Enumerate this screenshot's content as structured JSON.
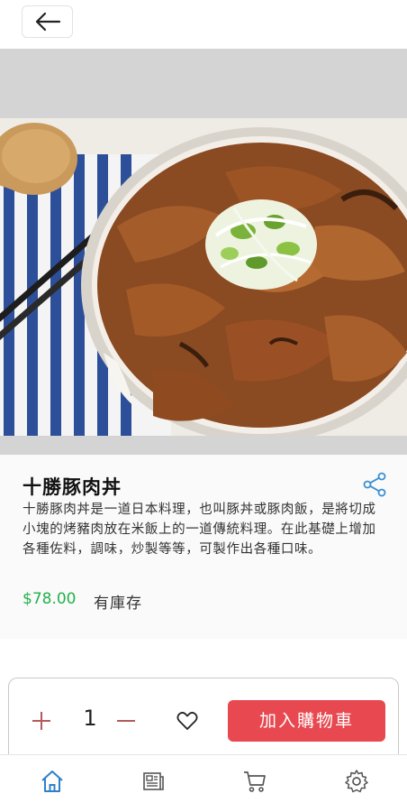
{
  "product": {
    "name": "十勝豚肉丼",
    "description": "十勝豚肉丼是一道日本料理，也叫豚丼或豚肉飯，是將切成小塊的烤豬肉放在米飯上的一道傳統料理。在此基礎上增加各種佐料，調味，炒製等等，可製作出各種口味。",
    "price": "$78.00",
    "stock_status": "有庫存"
  },
  "cart": {
    "quantity": "1",
    "add_to_cart_label": "加入購物車"
  },
  "icons": {
    "back": "arrow-left-icon",
    "share": "share-icon",
    "plus": "plus-icon",
    "minus": "minus-icon",
    "favorite": "heart-icon",
    "home": "home-icon",
    "catalog": "newspaper-icon",
    "cart": "cart-icon",
    "settings": "gear-icon"
  },
  "colors": {
    "price": "#22b14c",
    "primary_button": "#e84950",
    "nav_active": "#2f80c9",
    "share_icon": "#3a8fd1",
    "qty_controls": "#b35a5a"
  }
}
